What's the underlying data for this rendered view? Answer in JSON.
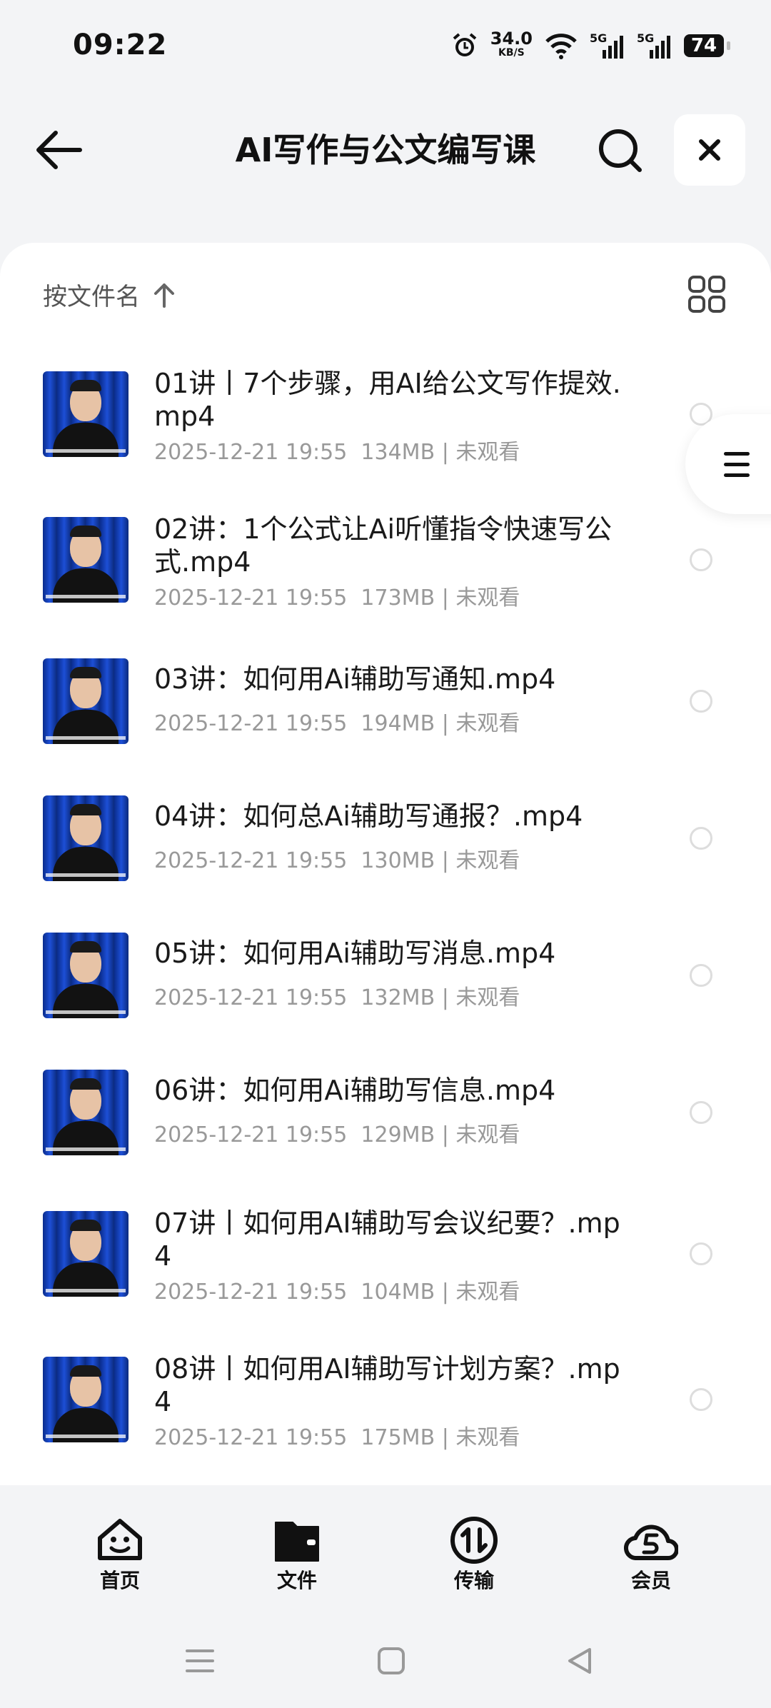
{
  "status_bar": {
    "time": "09:22",
    "net_speed": "34.0",
    "net_unit": "KB/S",
    "signal_1": "5G",
    "signal_2": "5G",
    "battery": "74"
  },
  "header": {
    "title": "AI写作与公文编写课"
  },
  "sort": {
    "label": "按文件名"
  },
  "files": [
    {
      "name": "01讲丨7个步骤，用AI给公文写作提效.mp4",
      "date": "2025-12-21 19:55",
      "size": "134MB",
      "status": "未观看"
    },
    {
      "name": "02讲：1个公式让Ai听懂指令快速写公式.mp4",
      "date": "2025-12-21 19:55",
      "size": "173MB",
      "status": "未观看"
    },
    {
      "name": "03讲：如何用Ai辅助写通知.mp4",
      "date": "2025-12-21 19:55",
      "size": "194MB",
      "status": "未观看"
    },
    {
      "name": "04讲：如何总Ai辅助写通报？.mp4",
      "date": "2025-12-21 19:55",
      "size": "130MB",
      "status": "未观看"
    },
    {
      "name": "05讲：如何用Ai辅助写消息.mp4",
      "date": "2025-12-21 19:55",
      "size": "132MB",
      "status": "未观看"
    },
    {
      "name": "06讲：如何用Ai辅助写信息.mp4",
      "date": "2025-12-21 19:55",
      "size": "129MB",
      "status": "未观看"
    },
    {
      "name": "07讲丨如何用AI辅助写会议纪要？.mp4",
      "date": "2025-12-21 19:55",
      "size": "104MB",
      "status": "未观看"
    },
    {
      "name": "08讲丨如何用AI辅助写计划方案？.mp4",
      "date": "2025-12-21 19:55",
      "size": "175MB",
      "status": "未观看"
    }
  ],
  "tabs": [
    {
      "label": "首页",
      "icon": "smile-face-icon"
    },
    {
      "label": "文件",
      "icon": "wallet-folder-icon"
    },
    {
      "label": "传输",
      "icon": "transfer-icon"
    },
    {
      "label": "会员",
      "icon": "cloud-s-icon"
    }
  ],
  "colors": {
    "background": "#f3f4f6",
    "panel": "#ffffff",
    "meta_text": "#999999"
  }
}
